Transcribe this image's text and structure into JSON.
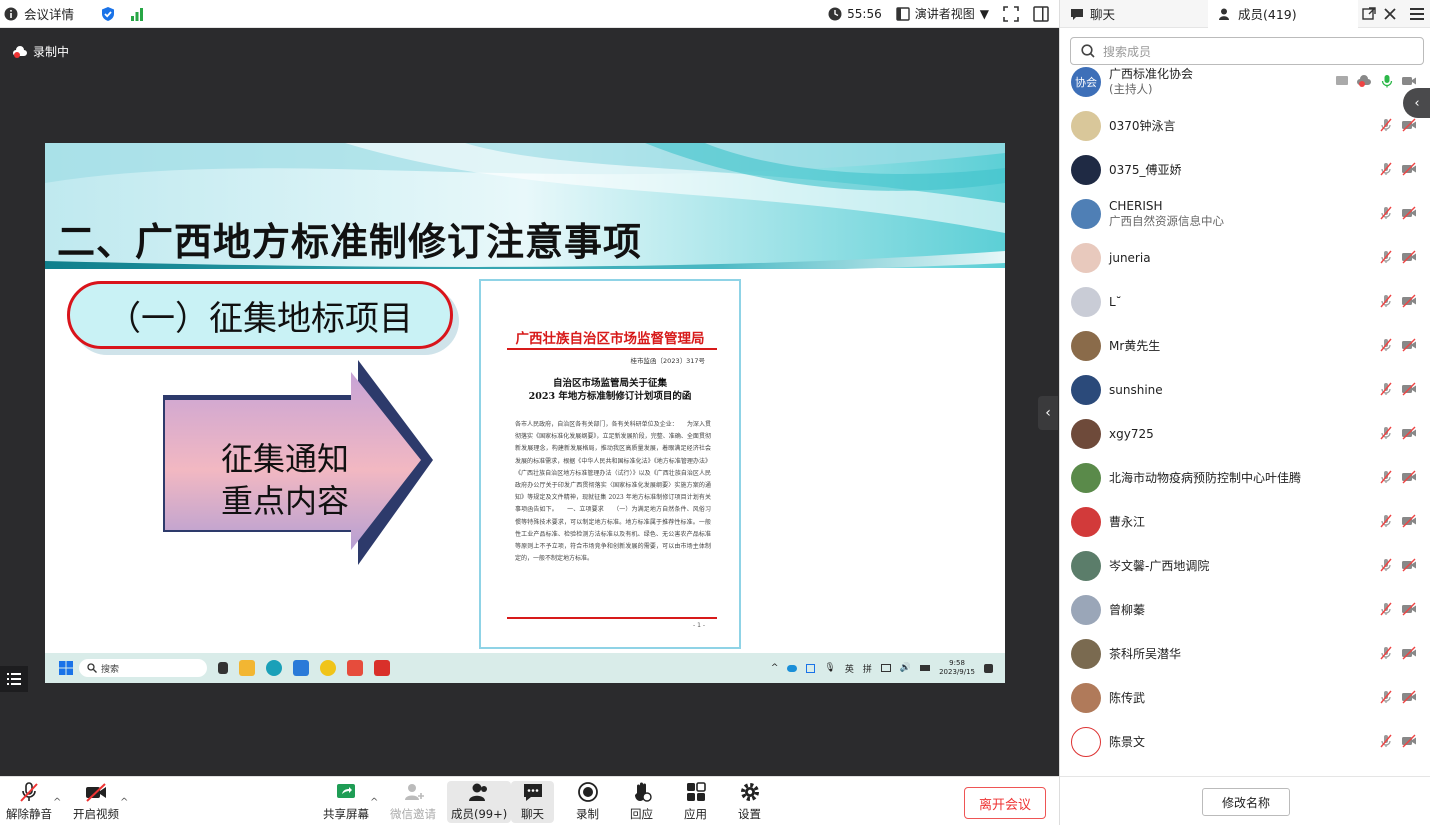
{
  "topbar": {
    "meeting_details": "会议详情",
    "timer": "55:56",
    "view_mode": "演讲者视图"
  },
  "recording": "录制中",
  "slide": {
    "title": "二、广西地方标准制修订注意事项",
    "subtitle": "（一）征集地标项目",
    "arrow_line1": "征集通知",
    "arrow_line2": "重点内容",
    "doc": {
      "org": "广西壮族自治区市场监督管理局",
      "number": "桂市监函〔2023〕317号",
      "title_line1": "自治区市场监管局关于征集",
      "title_line2": "2023 年地方标准制修订计划项目的函",
      "body": "各市人民政府，自治区各有关部门，各有关科研单位及企业：　　为深入贯彻落实《国家标准化发展纲要》，立足新发展阶段，完整、准确、全面贯彻新发展理念，构建新发展格局，推动我区高质量发展，着眼满足经济社会发展的标准需求，根据《中华人民共和国标准化法》《地方标准管理办法》《广西壮族自治区地方标准管理办法（试行）》以及《广西壮族自治区人民政府办公厅关于印发广西贯彻落实〈国家标准化发展纲要〉实施方案的通知》等规定及文件精神，现就征集 2023 年地方标准制修订项目计划有关事项函告如下。　　一、立项要求　　（一）为满足地方自然条件、风俗习惯等特殊技术要求，可以制定地方标准。地方标准属于推荐性标准。一般性工业产品标准、检验检测方法标准以及有机、绿色、无公害农产品标准等原则上不予立项，符合市场竞争和创新发展的需要，可以由市场主体制定的，一般不制定地方标准。",
      "page": "- 1 -"
    },
    "taskbar": {
      "search": "搜索",
      "ime1": "英",
      "ime2": "拼",
      "time": "9:58",
      "date": "2023/9/15"
    }
  },
  "bottom": {
    "unmute": "解除静音",
    "video": "开启视频",
    "share": "共享屏幕",
    "wechat_invite": "微信邀请",
    "members": "成员(99+)",
    "chat": "聊天",
    "record": "录制",
    "playback": "回应",
    "apps": "应用",
    "settings": "设置",
    "leave": "离开会议"
  },
  "side": {
    "tab_chat": "聊天",
    "tab_members": "成员(419)",
    "search_placeholder": "搜索成员",
    "rename": "修改名称",
    "members": [
      {
        "name": "广西标准化协会",
        "sub": "(主持人)",
        "avatar_text": "协会",
        "color": "#3d6fb8"
      },
      {
        "name": "0370钟泳言",
        "sub": "",
        "avatar_text": "",
        "color": "#d9c79a"
      },
      {
        "name": "0375_傅亚娇",
        "sub": "",
        "avatar_text": "",
        "color": "#1f2a44"
      },
      {
        "name": "CHERISH",
        "sub": "广西自然资源信息中心",
        "avatar_text": "",
        "color": "#4f7fb5"
      },
      {
        "name": "juneria",
        "sub": "",
        "avatar_text": "",
        "color": "#e8c9bd"
      },
      {
        "name": "L˘",
        "sub": "",
        "avatar_text": "",
        "color": "#c9ccd6"
      },
      {
        "name": "Mr黄先生",
        "sub": "",
        "avatar_text": "",
        "color": "#8a6b4a"
      },
      {
        "name": "sunshine",
        "sub": "",
        "avatar_text": "",
        "color": "#2b4a7a"
      },
      {
        "name": "xgy725",
        "sub": "",
        "avatar_text": "",
        "color": "#6e4a3a"
      },
      {
        "name": "北海市动物疫病预防控制中心叶佳腾",
        "sub": "",
        "avatar_text": "",
        "color": "#5a8a4a"
      },
      {
        "name": "曹永江",
        "sub": "",
        "avatar_text": "",
        "color": "#d23a3a"
      },
      {
        "name": "岑文馨-广西地调院",
        "sub": "",
        "avatar_text": "",
        "color": "#5b7d6a"
      },
      {
        "name": "曾柳蓁",
        "sub": "",
        "avatar_text": "",
        "color": "#9aa6b8"
      },
      {
        "name": "茶科所吴潜华",
        "sub": "",
        "avatar_text": "",
        "color": "#7a6a50"
      },
      {
        "name": "陈传武",
        "sub": "",
        "avatar_text": "",
        "color": "#b07a5a"
      },
      {
        "name": "陈景文",
        "sub": "",
        "avatar_text": "",
        "color": "#ffffff"
      }
    ]
  }
}
